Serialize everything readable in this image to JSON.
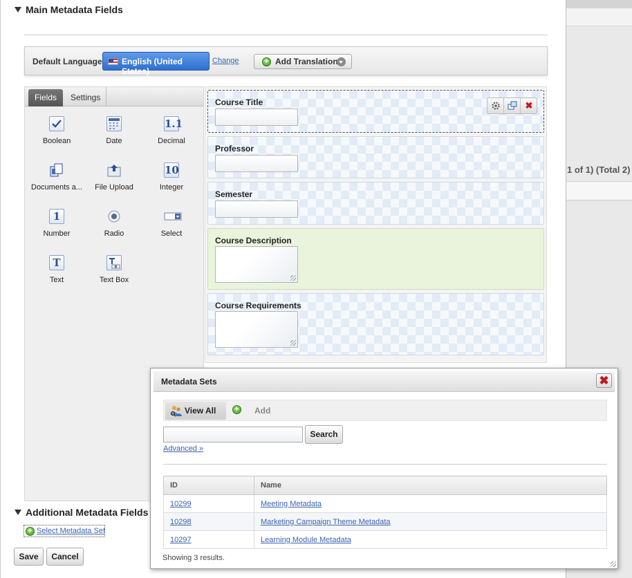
{
  "background": {
    "page_info": "1 of 1) (Total 2)"
  },
  "main_section": {
    "title": "Main Metadata Fields"
  },
  "language_bar": {
    "label": "Default Language:",
    "current_language": "English (United States)",
    "change_link": "Change",
    "add_translation": "Add Translation"
  },
  "palette": {
    "tabs": [
      "Fields",
      "Settings"
    ],
    "active_tab": "Fields",
    "tools": [
      {
        "label": "Boolean",
        "icon": "checkbox-icon"
      },
      {
        "label": "Date",
        "icon": "calendar-icon"
      },
      {
        "label": "Decimal",
        "icon": "decimal-icon",
        "glyph": "1.1"
      },
      {
        "label": "Documents a...",
        "icon": "documents-icon"
      },
      {
        "label": "File Upload",
        "icon": "file-upload-icon"
      },
      {
        "label": "Integer",
        "icon": "integer-icon",
        "glyph": "10"
      },
      {
        "label": "Number",
        "icon": "number-icon",
        "glyph": "1"
      },
      {
        "label": "Radio",
        "icon": "radio-icon"
      },
      {
        "label": "Select",
        "icon": "select-icon"
      },
      {
        "label": "Text",
        "icon": "text-icon",
        "glyph": "T"
      },
      {
        "label": "Text Box",
        "icon": "text-box-icon"
      }
    ]
  },
  "form_fields": [
    {
      "label": "Course Title",
      "type": "text",
      "selected": true
    },
    {
      "label": "Professor",
      "type": "text"
    },
    {
      "label": "Semester",
      "type": "text"
    },
    {
      "label": "Course Description",
      "type": "textarea",
      "highlighted": true
    },
    {
      "label": "Course Requirements",
      "type": "textarea"
    }
  ],
  "field_controls": {
    "settings_icon": "gear-icon",
    "duplicate_icon": "duplicate-icon",
    "delete_icon": "delete-icon"
  },
  "additional_section": {
    "title": "Additional Metadata Fields",
    "select_link": "Select Metadata Set"
  },
  "actions": {
    "save": "Save",
    "cancel": "Cancel"
  },
  "dialog": {
    "title": "Metadata Sets",
    "view_all": "View All",
    "add": "Add",
    "search_value": "",
    "search_button": "Search",
    "advanced_link": "Advanced »",
    "columns": [
      "ID",
      "Name"
    ],
    "rows": [
      {
        "id": "10299",
        "name": "Meeting Metadata"
      },
      {
        "id": "10298",
        "name": "Marketing Campaign Theme Metadata"
      },
      {
        "id": "10297",
        "name": "Learning Module Metadata"
      }
    ],
    "footer": "Showing 3 results."
  },
  "colors": {
    "accent": "#2e6fd0",
    "link": "#3a63b0",
    "close_red": "#c8141c",
    "highlight": "#eaf3dc"
  }
}
